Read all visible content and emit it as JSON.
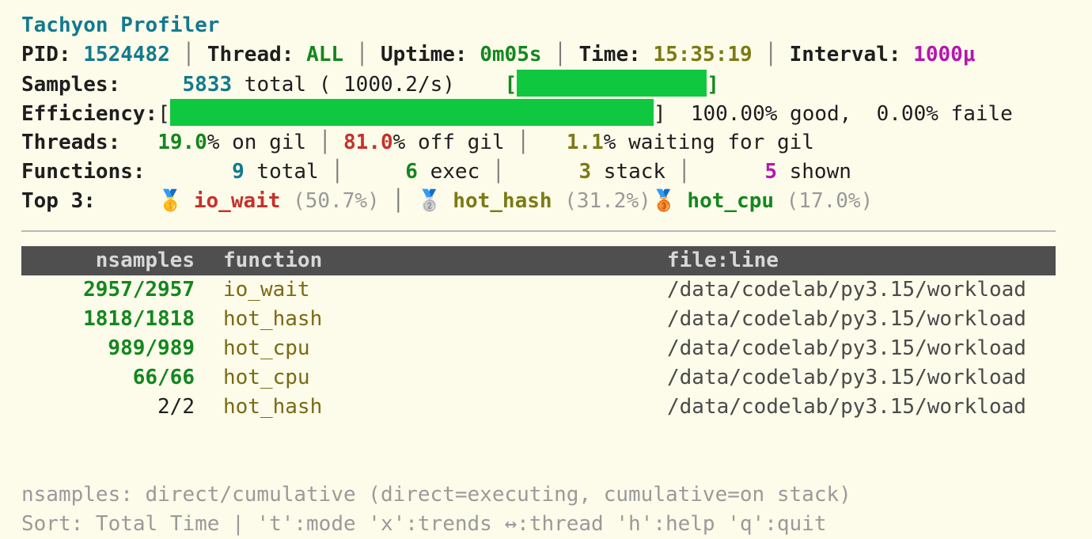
{
  "app": {
    "title": "Tachyon Profiler"
  },
  "status": {
    "pid_label": "PID:",
    "pid": "1524482",
    "thread_label": "Thread:",
    "thread": "ALL",
    "uptime_label": "Uptime:",
    "uptime": "0m05s",
    "time_label": "Time:",
    "time": "15:35:19",
    "interval_label": "Interval:",
    "interval": "1000μ"
  },
  "samples": {
    "label": "Samples:",
    "total": "5833",
    "total_text": " total ( 1000.2/s)",
    "bar_fraction": 1.0
  },
  "efficiency": {
    "label": "Efficiency:",
    "bar_fraction": 1.0,
    "good": "100.00% good,",
    "failed": "0.00% faile"
  },
  "threads": {
    "label": "Threads:",
    "on_gil": "19.0",
    "on_gil_text": "% on gil",
    "off_gil": "81.0",
    "off_gil_text": "% off gil",
    "waiting": "1.1",
    "waiting_text": "% waiting for gil"
  },
  "functions": {
    "label": "Functions:",
    "total": "9",
    "total_text": " total",
    "exec": "6",
    "exec_text": " exec",
    "stack": "3",
    "stack_text": " stack",
    "shown": "5",
    "shown_text": " shown"
  },
  "top3": {
    "label": "Top 3:",
    "items": [
      {
        "medal": "🥇",
        "name": "io_wait",
        "pct": "(50.7%)"
      },
      {
        "medal": "🥈",
        "name": "hot_hash",
        "pct": "(31.2%)"
      },
      {
        "medal": "🥉",
        "name": "hot_cpu",
        "pct": "(17.0%)"
      }
    ]
  },
  "table": {
    "headers": {
      "nsamples": "nsamples",
      "function": "function",
      "fileline": "file:line"
    },
    "rows": [
      {
        "nsamples": "2957/2957",
        "function": "io_wait",
        "fileline": "/data/codelab/py3.15/workload"
      },
      {
        "nsamples": "1818/1818",
        "function": "hot_hash",
        "fileline": "/data/codelab/py3.15/workload"
      },
      {
        "nsamples": "989/989",
        "function": "hot_cpu",
        "fileline": "/data/codelab/py3.15/workload"
      },
      {
        "nsamples": "66/66",
        "function": "hot_cpu",
        "fileline": "/data/codelab/py3.15/workload"
      },
      {
        "nsamples": "2/2",
        "function": "hot_hash",
        "fileline": "/data/codelab/py3.15/workload"
      }
    ]
  },
  "footer": {
    "legend": "nsamples: direct/cumulative (direct=executing, cumulative=on stack)",
    "help": "Sort: Total Time | 't':mode 'x':trends ↔:thread 'h':help 'q':quit"
  },
  "colors": {
    "background": "#fdfbea",
    "accent_teal": "#127a8f",
    "good_green": "#13871f",
    "bar_green": "#10c840",
    "warn_olive": "#7c7a14",
    "magenta": "#b616b0",
    "bad_red": "#c5312c",
    "header_bg": "#4f4f4f"
  }
}
